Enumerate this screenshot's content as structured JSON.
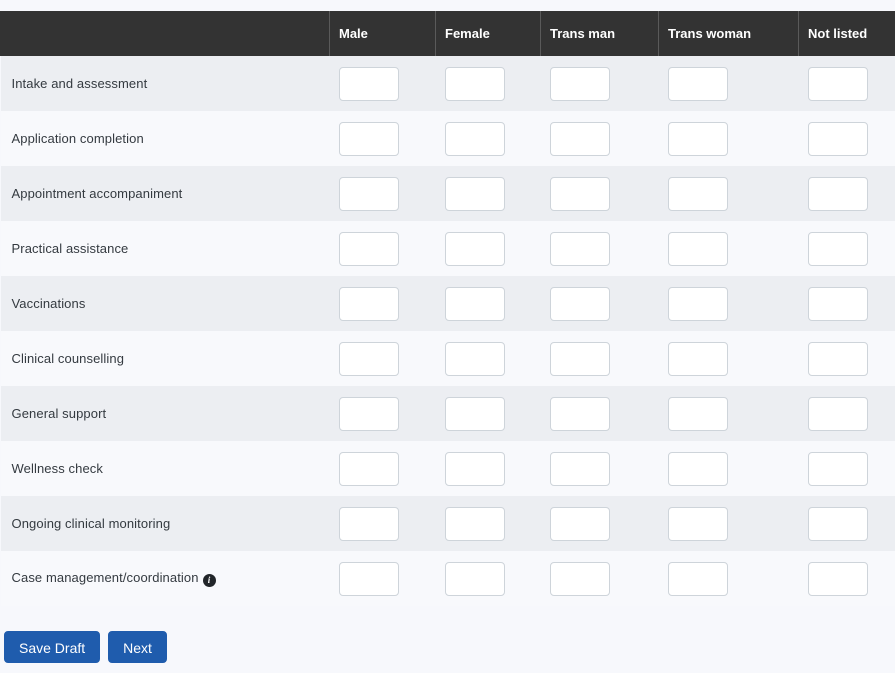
{
  "table": {
    "label_column_header": "",
    "columns": [
      {
        "id": "male",
        "label": "Male"
      },
      {
        "id": "female",
        "label": "Female"
      },
      {
        "id": "trans_man",
        "label": "Trans man"
      },
      {
        "id": "trans_woman",
        "label": "Trans woman"
      },
      {
        "id": "not_listed",
        "label": "Not listed"
      }
    ],
    "rows": [
      {
        "label": "Intake and assessment",
        "info": false,
        "values": [
          "",
          "",
          "",
          "",
          ""
        ]
      },
      {
        "label": "Application completion",
        "info": false,
        "values": [
          "",
          "",
          "",
          "",
          ""
        ]
      },
      {
        "label": "Appointment accompaniment",
        "info": false,
        "values": [
          "",
          "",
          "",
          "",
          ""
        ]
      },
      {
        "label": "Practical assistance",
        "info": false,
        "values": [
          "",
          "",
          "",
          "",
          ""
        ]
      },
      {
        "label": "Vaccinations",
        "info": false,
        "values": [
          "",
          "",
          "",
          "",
          ""
        ]
      },
      {
        "label": "Clinical counselling",
        "info": false,
        "values": [
          "",
          "",
          "",
          "",
          ""
        ]
      },
      {
        "label": "General support",
        "info": false,
        "values": [
          "",
          "",
          "",
          "",
          ""
        ]
      },
      {
        "label": "Wellness check",
        "info": false,
        "values": [
          "",
          "",
          "",
          "",
          ""
        ]
      },
      {
        "label": "Ongoing clinical monitoring",
        "info": false,
        "values": [
          "",
          "",
          "",
          "",
          ""
        ]
      },
      {
        "label": "Case management/coordination",
        "info": true,
        "values": [
          "",
          "",
          "",
          "",
          ""
        ]
      }
    ],
    "info_icon_glyph": "i",
    "info_icon_name": "info-icon"
  },
  "footer": {
    "save_draft_label": "Save Draft",
    "next_label": "Next"
  },
  "colors": {
    "header_bg": "#333333",
    "header_text": "#ffffff",
    "row_odd_bg": "#eceef2",
    "row_even_bg": "#f8f9fc",
    "page_bg": "#f7f8fc",
    "button_blue": "#1f5cad",
    "input_border": "#ced4da",
    "label_text": "#343a40"
  }
}
